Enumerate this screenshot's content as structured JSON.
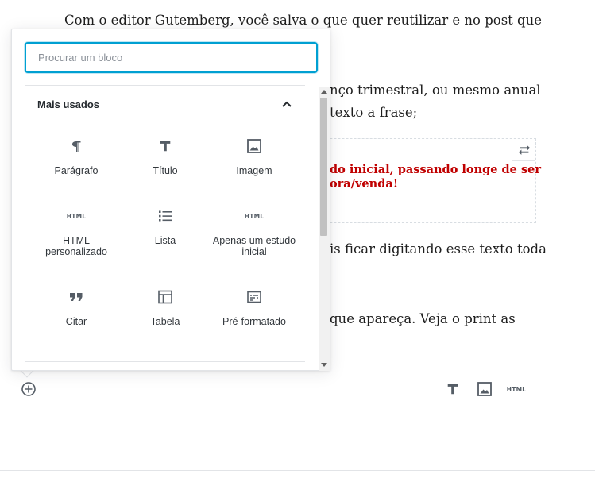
{
  "editor": {
    "paragraphs": [
      {
        "text": "Com o editor Gutemberg, você salva o que quer reutilizar e no post que"
      },
      {
        "text": "nço trimestral, ou mesmo anual"
      },
      {
        "text": "texto a frase;"
      },
      {
        "text": "is ficar digitando esse texto toda"
      },
      {
        "text": "que apareça. Veja o print as"
      }
    ],
    "reusable_block": {
      "line1": "do inicial, passando longe de ser",
      "line2": "ora/venda!",
      "text_color": "#c00000",
      "switch_icon": "convert-arrows-icon"
    },
    "inserter_icon": "plus-circle-icon",
    "shortcuts": {
      "heading_glyph": "T",
      "image_icon": "image-icon",
      "html_glyph": "HTML"
    }
  },
  "inserter": {
    "search_placeholder": "Procurar um bloco",
    "accent_color": "#00a0d2",
    "panel": {
      "title": "Mais usados",
      "toggle_icon": "chevron-up-icon"
    },
    "blocks": [
      {
        "label": "Parágrafo",
        "icon": "paragraph-icon"
      },
      {
        "label": "Título",
        "icon": "heading-icon",
        "glyph": "T"
      },
      {
        "label": "Imagem",
        "icon": "image-icon"
      },
      {
        "label": "HTML personalizado",
        "icon": "html-icon",
        "glyph": "HTML"
      },
      {
        "label": "Lista",
        "icon": "list-icon"
      },
      {
        "label": "Apenas um estudo inicial",
        "icon": "html-icon",
        "glyph": "HTML"
      },
      {
        "label": "Citar",
        "icon": "quote-icon"
      },
      {
        "label": "Tabela",
        "icon": "table-icon"
      },
      {
        "label": "Pré-formatado",
        "icon": "preformatted-icon"
      }
    ]
  }
}
